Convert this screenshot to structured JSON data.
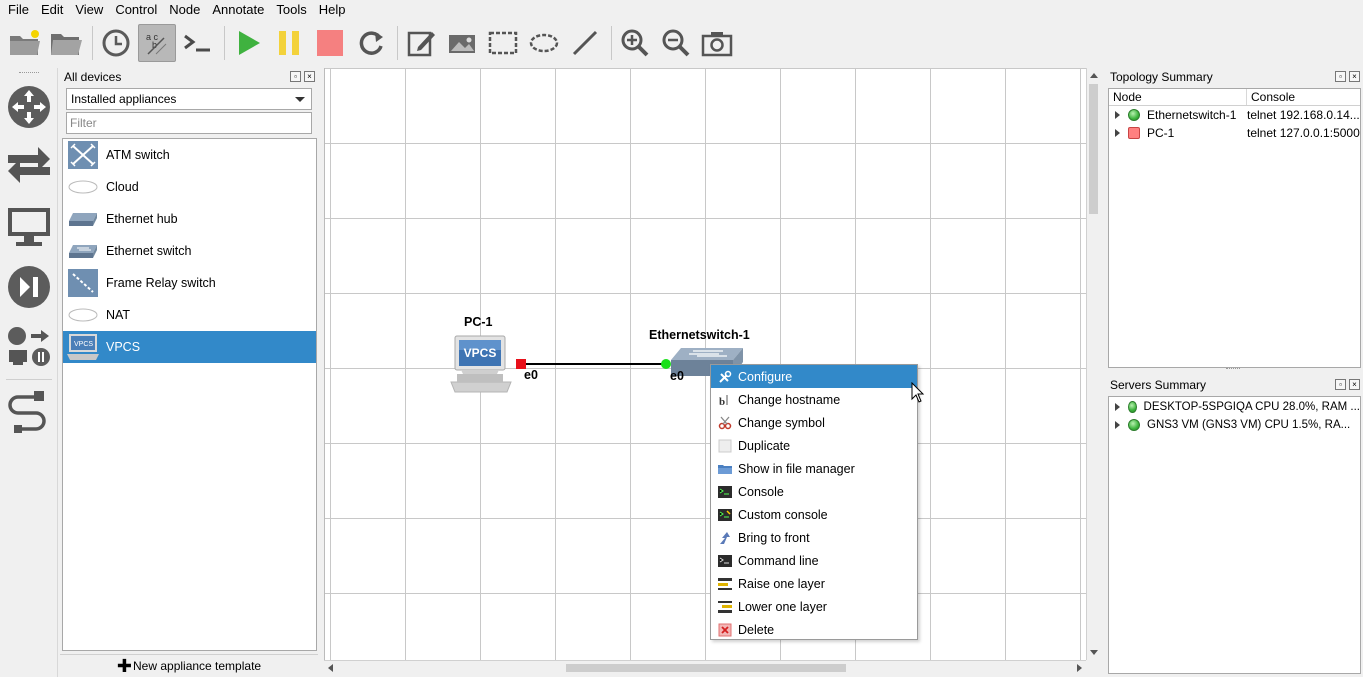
{
  "menu": [
    "File",
    "Edit",
    "View",
    "Control",
    "Node",
    "Annotate",
    "Tools",
    "Help"
  ],
  "device_panel": {
    "title": "All devices",
    "selector_value": "Installed appliances",
    "filter_placeholder": "Filter",
    "devices": [
      {
        "label": "ATM switch",
        "icon": "atm-switch-icon"
      },
      {
        "label": "Cloud",
        "icon": "cloud-icon"
      },
      {
        "label": "Ethernet hub",
        "icon": "ethernet-hub-icon"
      },
      {
        "label": "Ethernet switch",
        "icon": "ethernet-switch-icon"
      },
      {
        "label": "Frame Relay switch",
        "icon": "frame-relay-switch-icon"
      },
      {
        "label": "NAT",
        "icon": "nat-icon"
      },
      {
        "label": "VPCS",
        "icon": "vpcs-icon",
        "selected": true
      }
    ],
    "new_template": "New appliance template"
  },
  "canvas": {
    "nodes": [
      {
        "name": "PC-1",
        "port": "e0",
        "badge": "VPCS"
      },
      {
        "name": "Ethernetswitch-1",
        "port": "e0"
      }
    ]
  },
  "context_menu": {
    "items": [
      {
        "label": "Configure",
        "icon": "wrench-icon",
        "highlighted": true
      },
      {
        "label": "Change hostname",
        "icon": "hostname-icon"
      },
      {
        "label": "Change symbol",
        "icon": "scissors-icon"
      },
      {
        "label": "Duplicate",
        "icon": "duplicate-icon"
      },
      {
        "label": "Show in file manager",
        "icon": "folder-icon"
      },
      {
        "label": "Console",
        "icon": "console-icon"
      },
      {
        "label": "Custom console",
        "icon": "custom-console-icon"
      },
      {
        "label": "Bring to front",
        "icon": "bring-front-icon"
      },
      {
        "label": "Command line",
        "icon": "command-line-icon"
      },
      {
        "label": "Raise one layer",
        "icon": "raise-layer-icon"
      },
      {
        "label": "Lower one layer",
        "icon": "lower-layer-icon"
      },
      {
        "label": "Delete",
        "icon": "delete-icon"
      }
    ]
  },
  "topology_summary": {
    "title": "Topology Summary",
    "columns": [
      "Node",
      "Console"
    ],
    "rows": [
      {
        "node": "Ethernetswitch-1",
        "console": "telnet 192.168.0.14...",
        "status": "running"
      },
      {
        "node": "PC-1",
        "console": "telnet 127.0.0.1:5000",
        "status": "stopped"
      }
    ]
  },
  "servers_summary": {
    "title": "Servers Summary",
    "rows": [
      {
        "label": "DESKTOP-5SPGIQA CPU 28.0%, RAM ...",
        "status": "running"
      },
      {
        "label": "GNS3 VM (GNS3 VM) CPU 1.5%, RA...",
        "status": "running"
      }
    ]
  },
  "colors": {
    "selection": "#3289c9",
    "running": "#3cb33c",
    "stopped": "#ff8080",
    "link": "#000000"
  }
}
